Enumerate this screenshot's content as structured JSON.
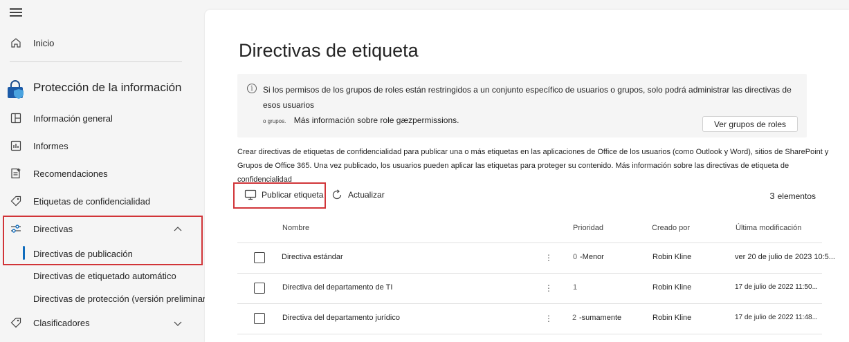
{
  "sidebar": {
    "home": "Inicio",
    "section_title": "Protección de la información",
    "items": [
      {
        "label": "Información general",
        "icon": "overview-icon"
      },
      {
        "label": "Informes",
        "icon": "reports-icon"
      },
      {
        "label": "Recomendaciones",
        "icon": "recommendations-icon"
      },
      {
        "label": "Etiquetas de confidencialidad",
        "icon": "sensitivity-label-icon"
      },
      {
        "label": "Directivas",
        "icon": "policies-icon"
      }
    ],
    "sub_items": [
      "Directivas de publicación",
      "Directivas de etiquetado automático",
      "Directivas de protección (versión preliminar)"
    ],
    "classifiers": "Clasificadores"
  },
  "main": {
    "title": "Directivas de etiqueta",
    "info": {
      "line1": "Si los permisos de los grupos de roles están restringidos a un conjunto específico de usuarios o grupos, solo podrá administrar las directivas de esos usuarios",
      "small": "o grupos.",
      "line2": "Más información sobre role gæzpermissions.",
      "button": "Ver grupos de roles"
    },
    "description_line1": "Crear directivas de etiquetas de confidencialidad para publicar una o más etiquetas en las aplicaciones de Office de los usuarios (como Outlook y Word), sitios de SharePoint y",
    "description_line2": "Grupos de Office 365. Una vez publicado, los usuarios pueden aplicar las etiquetas para proteger su contenido. Más información sobre las directivas de etiqueta de confidencialidad",
    "toolbar": {
      "publish": "Publicar etiqueta",
      "refresh": "Actualizar",
      "count_num": "3",
      "count_label": "elementos"
    },
    "table": {
      "headers": [
        "Nombre",
        "Prioridad",
        "Creado por",
        "Última modificación"
      ],
      "rows": [
        {
          "name": "Directiva estándar",
          "prio_num": "0",
          "prio_label": "-Menor",
          "created_by": "Robin Kline",
          "modified": "ver 20 de julio de 2023 10:5..."
        },
        {
          "name": "Directiva del departamento de TI",
          "prio_num": "1",
          "prio_label": "",
          "created_by": "Robin Kline",
          "modified": "17 de julio de 2022 11:50..."
        },
        {
          "name": "Directiva del departamento jurídico",
          "prio_num": "2",
          "prio_label": "-sumamente",
          "created_by": "Robin Kline",
          "modified": "17 de julio de 2022 11:48..."
        }
      ]
    }
  },
  "colors": {
    "accent": "#0f6cbd",
    "highlight": "#d13438",
    "background": "#f5f5f5"
  }
}
